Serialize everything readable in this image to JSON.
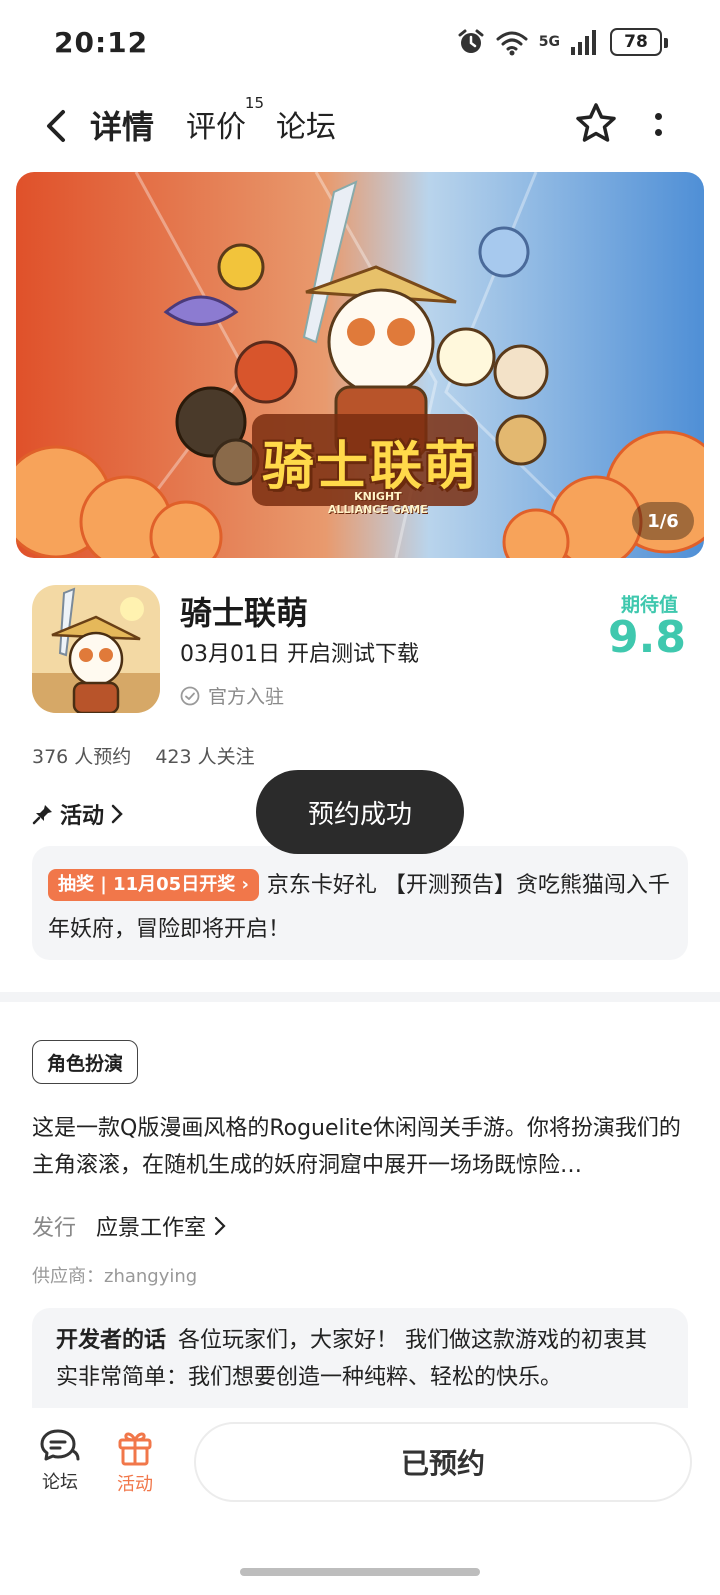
{
  "status_bar": {
    "time": "20:12",
    "network_label": "5G",
    "battery": "78",
    "icons": [
      "alarm-icon",
      "wifi-icon",
      "signal-icon",
      "battery-icon"
    ]
  },
  "nav": {
    "tabs": [
      {
        "label": "详情",
        "active": true
      },
      {
        "label": "评价",
        "count": "15"
      },
      {
        "label": "论坛"
      }
    ]
  },
  "banner": {
    "title": "骑士联萌",
    "subtitle_line1": "KNIGHT",
    "subtitle_line2": "ALLIANCE GAME",
    "counter": "1/6"
  },
  "game": {
    "name": "骑士联萌",
    "release": "03月01日 开启测试下载",
    "official": "官方入驻",
    "expect_label": "期待值",
    "expect_value": "9.8",
    "reservations": "376 人预约",
    "follows": "423 人关注"
  },
  "activity": {
    "heading": "活动",
    "tag": "抽奖 | 11月05日开奖 ›",
    "text": "京东卡好礼 【开测预告】贪吃熊猫闯入千年妖府，冒险即将开启！"
  },
  "toast": "预约成功",
  "details": {
    "genre": "角色扮演",
    "description": "这是一款Q版漫画风格的Roguelite休闲闯关手游。你将扮演我们的主角滚滚，在随机生成的妖府洞窟中展开一场场既惊险…",
    "publisher_label": "发行",
    "publisher_name": "应景工作室",
    "supplier": "供应商：zhangying",
    "dev_label": "开发者的话",
    "dev_text": "各位玩家们，大家好！ 我们做这款游戏的初衷其实非常简单：我们想要创造一种纯粹、轻松的快乐。"
  },
  "bottom": {
    "forum_label": "论坛",
    "activity_label": "活动",
    "reserve_label": "已预约"
  },
  "colors": {
    "accent": "#3fc8ae",
    "lottery": "#f1774a",
    "active_bottom": "#f1774a"
  }
}
